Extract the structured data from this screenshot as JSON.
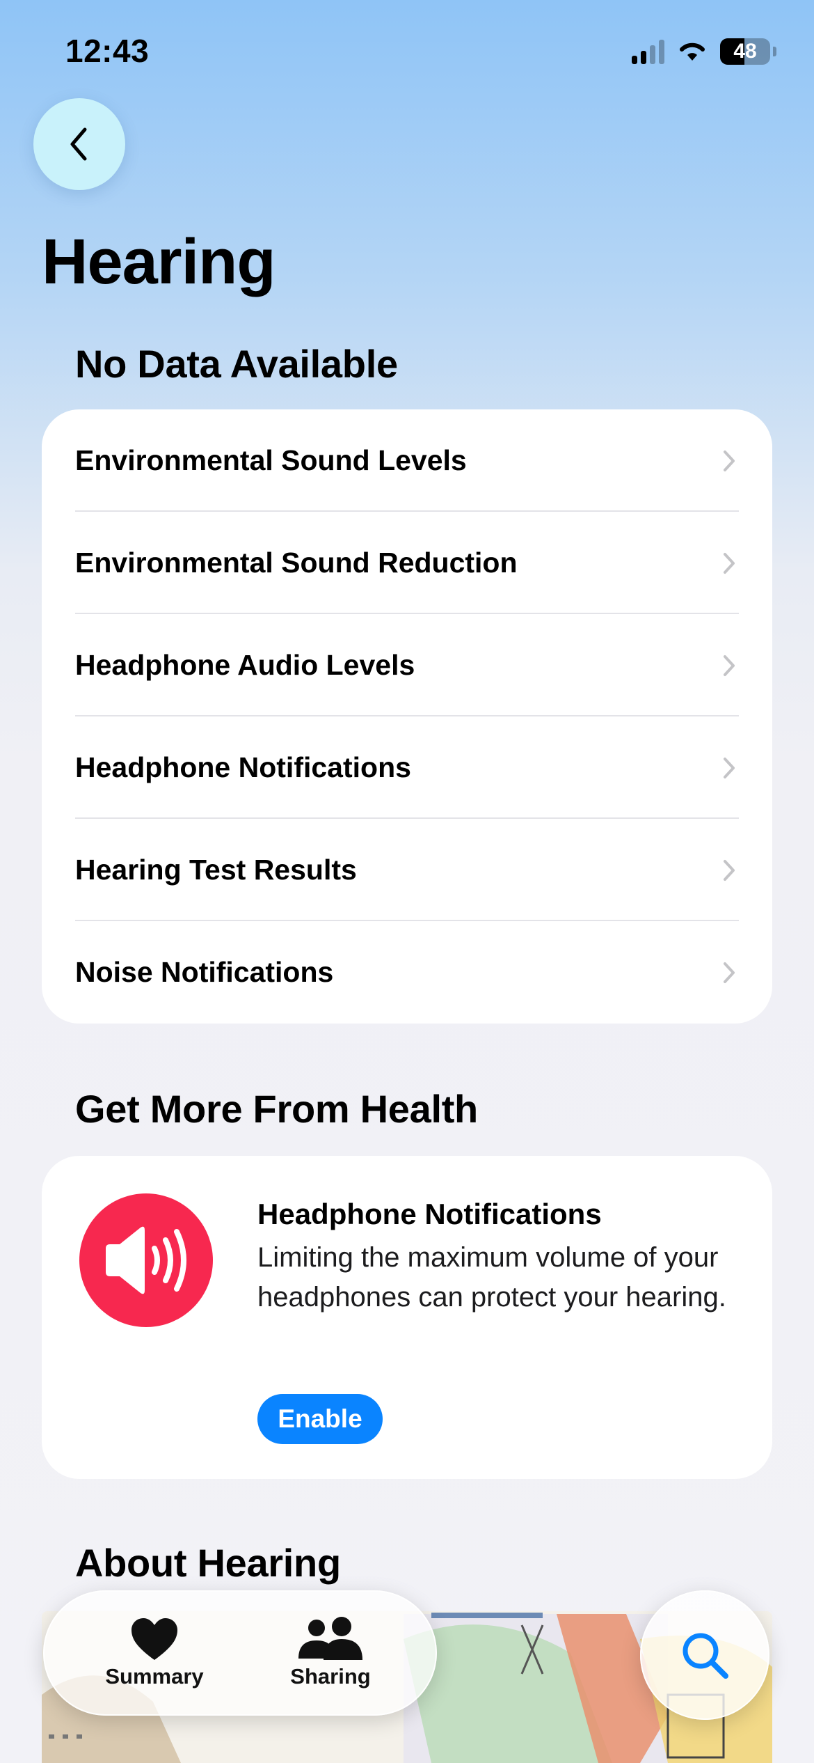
{
  "status_bar": {
    "time": "12:43",
    "battery_percent": "48",
    "battery_level": 0.48,
    "signal_bars_active": 2,
    "signal_bars_total": 4
  },
  "nav": {
    "back_icon": "chevron-left-icon"
  },
  "page": {
    "title": "Hearing"
  },
  "no_data": {
    "section_title": "No Data Available",
    "items": [
      {
        "label": "Environmental Sound Levels"
      },
      {
        "label": "Environmental Sound Reduction"
      },
      {
        "label": "Headphone Audio Levels"
      },
      {
        "label": "Headphone Notifications"
      },
      {
        "label": "Hearing Test Results"
      },
      {
        "label": "Noise Notifications"
      }
    ]
  },
  "get_more": {
    "section_title": "Get More From Health",
    "card": {
      "icon": "speaker-wave-icon",
      "icon_color": "#f7284f",
      "title": "Headphone Notifications",
      "body": "Limiting the maximum volume of your headphones can protect your hearing.",
      "button_label": "Enable",
      "button_color": "#0a84ff"
    }
  },
  "about": {
    "section_title": "About Hearing"
  },
  "tab_bar": {
    "tabs": [
      {
        "label": "Summary",
        "icon": "heart-icon"
      },
      {
        "label": "Sharing",
        "icon": "people-icon"
      }
    ],
    "search_icon": "search-icon",
    "search_color": "#0a84ff"
  }
}
